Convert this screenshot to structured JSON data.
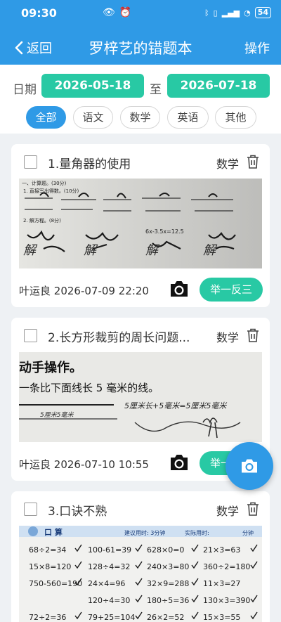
{
  "status_bar": {
    "time": "09:30",
    "battery": "54"
  },
  "nav": {
    "back_label": "返回",
    "title": "罗梓艺的错题本",
    "action_label": "操作"
  },
  "filter": {
    "date_label": "日期",
    "start_date": "2026-05-18",
    "to_label": "至",
    "end_date": "2026-07-18",
    "subjects": [
      "全部",
      "语文",
      "数学",
      "英语",
      "其他"
    ],
    "active_subject": "全部"
  },
  "cards": [
    {
      "title": "1.量角器的使用",
      "subject": "数学",
      "author": "叶运良",
      "datetime": "2026-07-09 22:20",
      "button": "举一反三"
    },
    {
      "title": "2.长方形裁剪的周长问题...",
      "subject": "数学",
      "author": "叶运良",
      "datetime": "2026-07-10 10:55",
      "button": "举一反三"
    },
    {
      "title": "3.口诀不熟",
      "subject": "数学",
      "author": "",
      "datetime": "",
      "button": ""
    }
  ],
  "worksheet_text": {
    "card1": [
      "一、计算题。(30分)",
      "1. 直接写出得数。(10分)",
      "2. 解方程。(8分)",
      "6x-3.5x=12.5"
    ],
    "card2": [
      "动手操作。",
      "一条比下面线长 5 毫米的线。",
      "5厘米长+5毫米=5厘米5毫米"
    ],
    "card3_header": [
      "口 算",
      "建议用时: 3分钟",
      "实际用时:",
      "分钟"
    ],
    "card3_rows": [
      [
        "68÷2=34",
        "100-61=39",
        "628×0=0",
        "21×3=63"
      ],
      [
        "15×8=120",
        "128÷4=32",
        "240×3=80",
        "360÷2=180"
      ],
      [
        "750-560=190",
        "24×4=96",
        "32×9=288",
        "11×3=27"
      ],
      [
        "",
        "120÷4=30",
        "180÷5=36",
        "130×3=390"
      ],
      [
        "72÷2=36",
        "79+25=104",
        "26×2=52",
        "15×3=55"
      ]
    ]
  },
  "colors": {
    "primary": "#2f9ae6",
    "accent": "#28c9a4"
  }
}
